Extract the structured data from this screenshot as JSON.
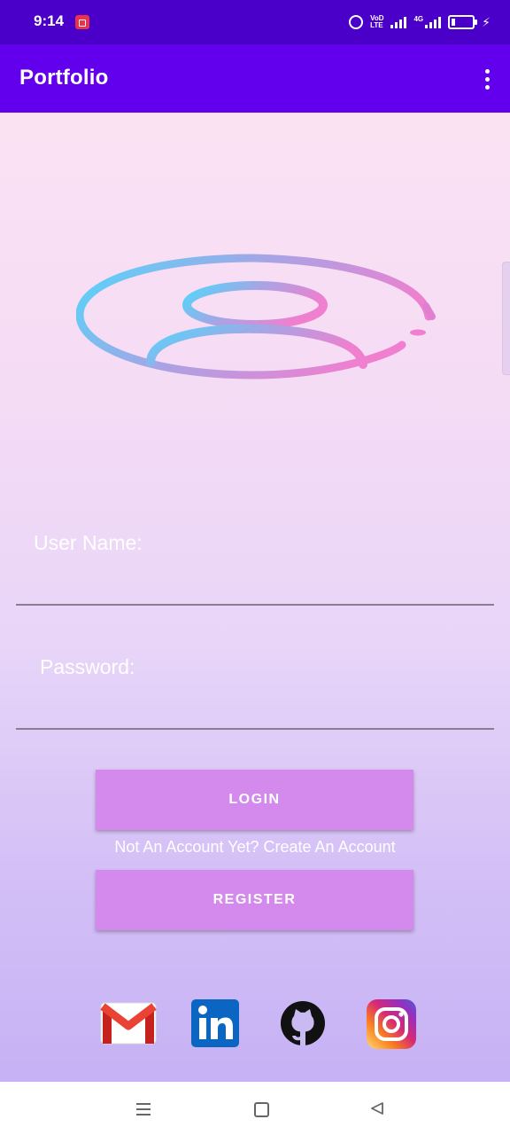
{
  "status_bar": {
    "time": "9:14",
    "network_label_1": "VoD",
    "network_label_2": "LTE",
    "network_label_3": "4G"
  },
  "app_bar": {
    "title": "Portfolio"
  },
  "form": {
    "username_label": "User Name:",
    "username_value": "",
    "password_label": "Password:",
    "password_value": "",
    "login_label": "LOGIN",
    "create_account_text": "Not An Account Yet? Create An Account",
    "register_label": "REGISTER"
  },
  "social": [
    "gmail-icon",
    "linkedin-icon",
    "github-icon",
    "instagram-icon"
  ],
  "colors": {
    "status_bar": "#4a00c9",
    "app_bar": "#6200ee",
    "button": "#d48aed"
  }
}
